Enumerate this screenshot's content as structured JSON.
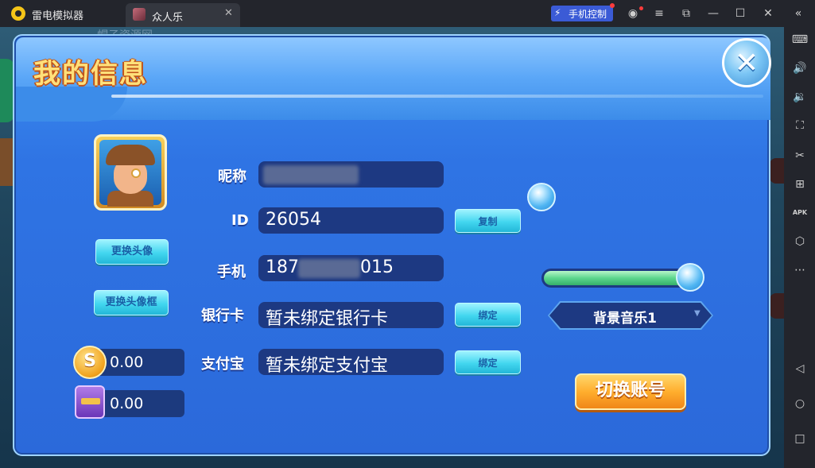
{
  "titlebar": {
    "app_name": "雷电模拟器",
    "tab_label": "众人乐",
    "tab_close": "✕",
    "phone_control": "手机控制",
    "icons": [
      "phone-bolt-icon",
      "user-icon",
      "menu-icon",
      "restore-icon",
      "minimize-icon",
      "maximize-icon",
      "close-icon",
      "collapse-icon"
    ]
  },
  "sidebar": {
    "icons": [
      "keyboard-icon",
      "volume-up-icon",
      "volume-down-icon",
      "screenshot-icon",
      "scissors-icon",
      "add-window-icon",
      "apk-icon",
      "settings-icon",
      "more-icon",
      "back-icon",
      "home-icon",
      "recent-icon"
    ],
    "apk_text": "APK"
  },
  "background": {
    "watermark": "帽子资源网"
  },
  "dialog": {
    "title": "我的信息",
    "close_symbol": "✕",
    "buttons": {
      "change_avatar": "更换头像",
      "change_frame": "更换头像框",
      "copy": "复制",
      "bind_bank": "绑定",
      "bind_alipay": "绑定",
      "switch_account": "切换账号"
    },
    "fields": {
      "nickname_label": "昵称",
      "nickname_value": "",
      "id_label": "ID",
      "id_value": "26054",
      "phone_label": "手机",
      "phone_prefix": "187",
      "phone_suffix": "015",
      "bank_label": "银行卡",
      "bank_value": "暂未绑定银行卡",
      "alipay_label": "支付宝",
      "alipay_value": "暂未绑定支付宝"
    },
    "currency": {
      "gold": "0.00",
      "bank": "0.00",
      "gold_symbol": "S"
    },
    "audio": {
      "music_select": "背景音乐1",
      "music_volume": 0.95
    }
  }
}
